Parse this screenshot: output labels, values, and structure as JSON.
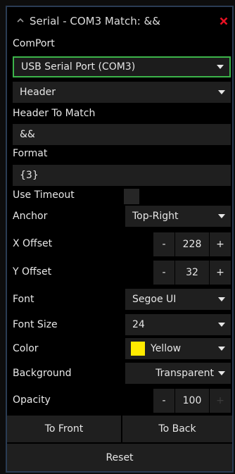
{
  "titlebar": {
    "title": "Serial - COM3  Match: &&",
    "close_color": "#e81123"
  },
  "comport": {
    "label": "ComPort",
    "value": "USB Serial Port (COM3)",
    "accent": "#3cb44a"
  },
  "mode": {
    "value": "Header"
  },
  "header_to_match": {
    "label": "Header To Match",
    "value": "&&"
  },
  "format": {
    "label": "Format",
    "value": "{3}"
  },
  "use_timeout": {
    "label": "Use Timeout",
    "checked": false
  },
  "anchor": {
    "label": "Anchor",
    "value": "Top-Right"
  },
  "x_offset": {
    "label": "X Offset",
    "minus": "-",
    "value": "228",
    "plus": "+"
  },
  "y_offset": {
    "label": "Y Offset",
    "minus": "-",
    "value": "32",
    "plus": "+"
  },
  "font": {
    "label": "Font",
    "value": "Segoe UI"
  },
  "font_size": {
    "label": "Font Size",
    "value": "24"
  },
  "color": {
    "label": "Color",
    "value": "Yellow",
    "swatch": "#ffea00"
  },
  "background": {
    "label": "Background",
    "value": "Transparent"
  },
  "opacity": {
    "label": "Opacity",
    "minus": "-",
    "value": "100",
    "plus": "+"
  },
  "buttons": {
    "to_front": "To Front",
    "to_back": "To Back",
    "reset": "Reset"
  }
}
